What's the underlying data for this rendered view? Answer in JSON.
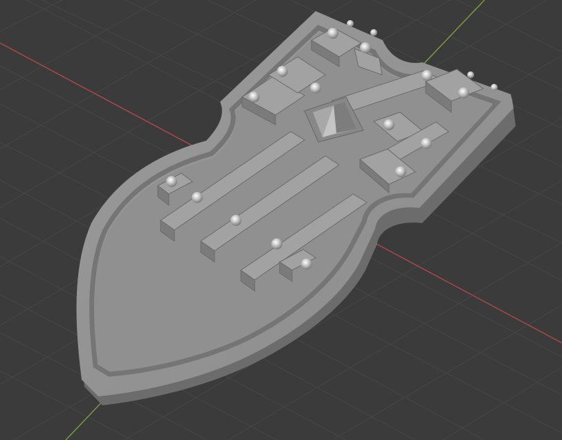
{
  "viewport": {
    "view": "3D Viewport",
    "background_color": "#3b3b3b",
    "grid_color": "#464646",
    "x_axis_color": "#b34848",
    "y_axis_color": "#7ba33c",
    "object": {
      "name": "shield-model",
      "shading": "solid",
      "base_color": "#8f8f8f",
      "side_color": "#6f6f6f",
      "studs": 18
    }
  }
}
